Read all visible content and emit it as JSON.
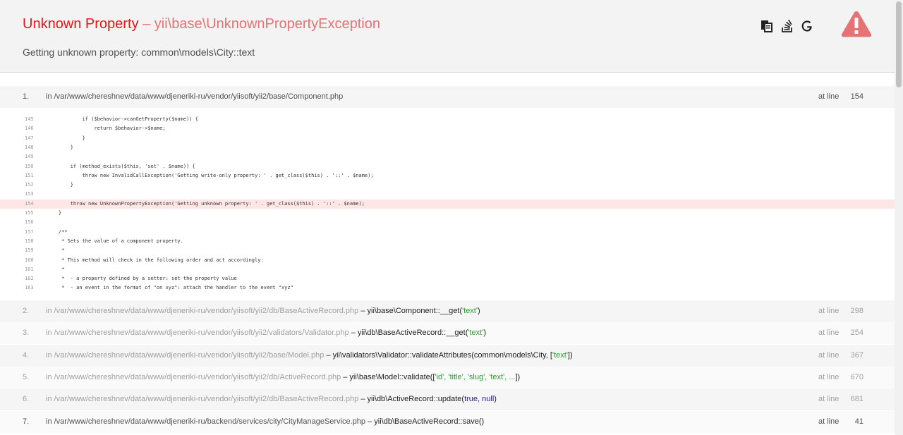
{
  "header": {
    "title_name": "Unknown Property",
    "title_dash": " – ",
    "title_class": "yii\\base\\UnknownPropertyException",
    "message": "Getting unknown property: common\\models\\City::text",
    "icons": [
      "copy-icon",
      "stackoverflow-icon",
      "google-icon",
      "warning-icon"
    ],
    "accent_color": "#e51717"
  },
  "first_call": {
    "num": "1.",
    "file": "in /var/www/chereshnev/data/www/djeneriki-ru/vendor/yiisoft/yii2/base/Component.php",
    "at_line": "at line",
    "line": "154"
  },
  "code_lines": [
    {
      "n": "145",
      "code": "            if ($behavior->canGetProperty($name)) {"
    },
    {
      "n": "146",
      "code": "                return $behavior->$name;"
    },
    {
      "n": "147",
      "code": "            }"
    },
    {
      "n": "148",
      "code": "        }"
    },
    {
      "n": "149",
      "code": ""
    },
    {
      "n": "150",
      "code": "        if (method_exists($this, 'set' . $name)) {"
    },
    {
      "n": "151",
      "code": "            throw new InvalidCallException('Getting write-only property: ' . get_class($this) . '::' . $name);"
    },
    {
      "n": "152",
      "code": "        }"
    },
    {
      "n": "153",
      "code": ""
    },
    {
      "n": "154",
      "code": "        throw new UnknownPropertyException('Getting unknown property: ' . get_class($this) . '::' . $name);"
    },
    {
      "n": "155",
      "code": "    }"
    },
    {
      "n": "156",
      "code": ""
    },
    {
      "n": "157",
      "code": "    /**"
    },
    {
      "n": "158",
      "code": "     * Sets the value of a component property."
    },
    {
      "n": "159",
      "code": "     *"
    },
    {
      "n": "160",
      "code": "     * This method will check in the following order and act accordingly:"
    },
    {
      "n": "161",
      "code": "     *"
    },
    {
      "n": "162",
      "code": "     *  - a property defined by a setter: set the property value"
    },
    {
      "n": "163",
      "code": "     *  - an event in the format of \"on xyz\": attach the handler to the event \"xyz\""
    }
  ],
  "highlight_line": "154",
  "calls": [
    {
      "num": "2.",
      "file": "in /var/www/chereshnev/data/www/djeneriki-ru/vendor/yiisoft/yii2/db/BaseActiveRecord.php",
      "sep": " – ",
      "method": "yii\\base\\Component::__get(",
      "arg": "'text'",
      "close": ")",
      "at_line": "at line",
      "line": "298"
    },
    {
      "num": "3.",
      "file": "in /var/www/chereshnev/data/www/djeneriki-ru/vendor/yiisoft/yii2/validators/Validator.php",
      "sep": " – ",
      "method": "yii\\db\\BaseActiveRecord::__get(",
      "arg": "'text'",
      "close": ")",
      "at_line": "at line",
      "line": "254"
    },
    {
      "num": "4.",
      "file": "in /var/www/chereshnev/data/www/djeneriki-ru/vendor/yiisoft/yii2/base/Model.php",
      "sep": " – ",
      "method": "yii\\validators\\Validator::validateAttributes(common\\models\\City, [",
      "arg": "'text'",
      "close": "])",
      "at_line": "at line",
      "line": "367"
    },
    {
      "num": "5.",
      "file": "in /var/www/chereshnev/data/www/djeneriki-ru/vendor/yiisoft/yii2/db/ActiveRecord.php",
      "sep": " – ",
      "method": "yii\\base\\Model::validate([",
      "arg": "'id', 'title', 'slug', 'text', ...",
      "close": "])",
      "at_line": "at line",
      "line": "670"
    },
    {
      "num": "6.",
      "file": "in /var/www/chereshnev/data/www/djeneriki-ru/vendor/yiisoft/yii2/db/BaseActiveRecord.php",
      "sep": " – ",
      "method": "yii\\db\\ActiveRecord::update(",
      "arg": "true, null",
      "close": ")",
      "at_line": "at line",
      "line": "681"
    },
    {
      "num": "7.",
      "file": "in /var/www/chereshnev/data/www/djeneriki-ru/backend/services/city/CityManageService.php",
      "sep": " – ",
      "method": "yii\\db\\BaseActiveRecord::save()",
      "arg": "",
      "close": "",
      "at_line": "at line",
      "line": "41"
    }
  ]
}
